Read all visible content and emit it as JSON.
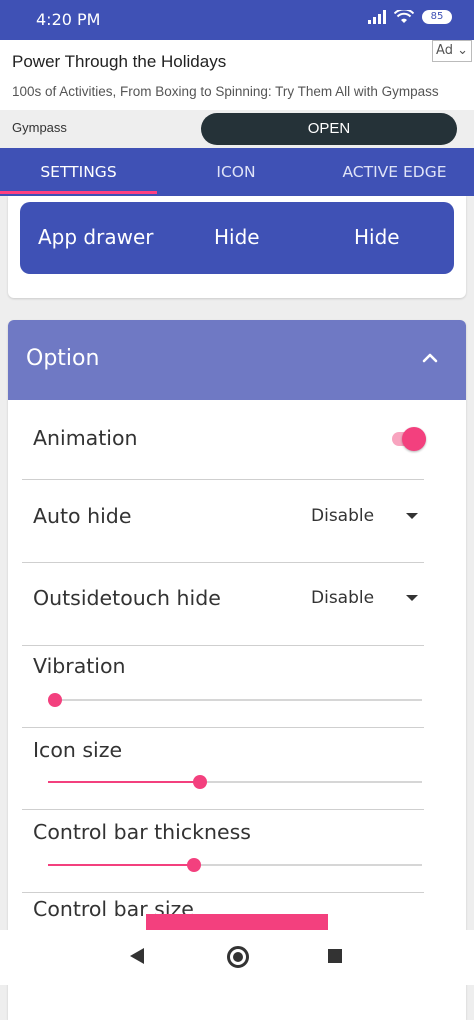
{
  "status": {
    "time": "4:20 PM",
    "battery": "85"
  },
  "ad": {
    "title": "Power Through the Holidays",
    "description": "100s of Activities, From Boxing to Spinning: Try Them All with Gympass",
    "badge": "Ad",
    "brand": "Gympass",
    "cta": "OPEN"
  },
  "tabs": [
    "SETTINGS",
    "ICON",
    "ACTIVE EDGE"
  ],
  "app_drawer": {
    "label": "App drawer",
    "value1": "Hide",
    "value2": "Hide"
  },
  "option": {
    "title": "Option",
    "animation": {
      "label": "Animation",
      "enabled": true
    },
    "auto_hide": {
      "label": "Auto hide",
      "value": "Disable"
    },
    "outsidetouch_hide": {
      "label": "Outsidetouch hide",
      "value": "Disable"
    },
    "vibration": {
      "label": "Vibration",
      "level": 0
    },
    "icon_size": {
      "label": "Icon size",
      "level": 0.4
    },
    "control_bar_thickness": {
      "label": "Control bar thickness",
      "level": 0.385
    },
    "control_bar_size": {
      "label": "Control bar size"
    }
  },
  "colors": {
    "primary": "#3f51b5",
    "accent": "#f3407e",
    "header": "#6f79c4"
  }
}
